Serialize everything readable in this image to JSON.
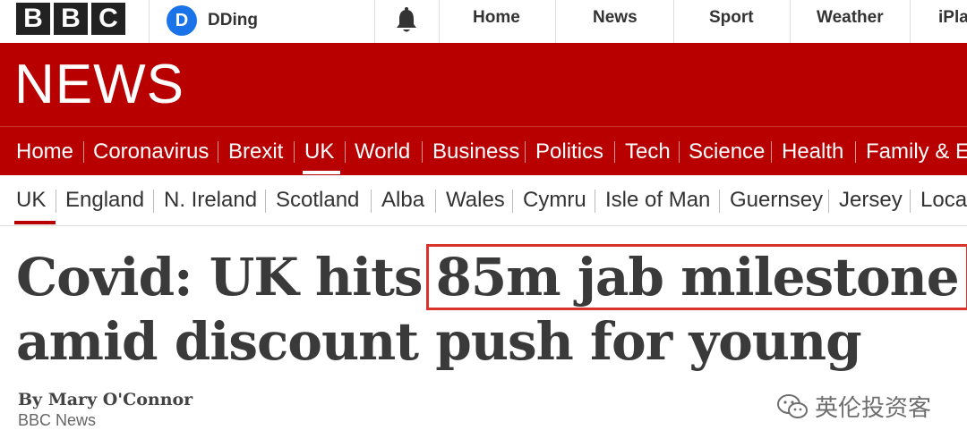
{
  "topbar": {
    "logo_letters": [
      "B",
      "B",
      "C"
    ],
    "account": {
      "initial": "D",
      "name": "DDing"
    },
    "nav": [
      "Home",
      "News",
      "Sport",
      "Weather",
      "iPla"
    ]
  },
  "banner": {
    "title": "NEWS"
  },
  "section_nav": {
    "items": [
      "Home",
      "Coronavirus",
      "Brexit",
      "UK",
      "World",
      "Business",
      "Politics",
      "Tech",
      "Science",
      "Health",
      "Family & E"
    ],
    "active": "UK"
  },
  "sub_nav": {
    "items": [
      "UK",
      "England",
      "N. Ireland",
      "Scotland",
      "Alba",
      "Wales",
      "Cymru",
      "Isle of Man",
      "Guernsey",
      "Jersey",
      "Loca"
    ],
    "active": "UK"
  },
  "article": {
    "headline_pre": "Covid: UK hits",
    "headline_highlight": "85m jab milestone",
    "headline_line2": "amid discount push for young",
    "author": "By Mary O'Connor",
    "org": "BBC News"
  },
  "watermark": {
    "text": "英伦投资客"
  },
  "colors": {
    "brand_red": "#b80000",
    "highlight_box": "#d9332c",
    "avatar_blue": "#1a73e8"
  },
  "icons": {
    "notifications": "bell-icon",
    "watermark": "wechat-icon"
  }
}
